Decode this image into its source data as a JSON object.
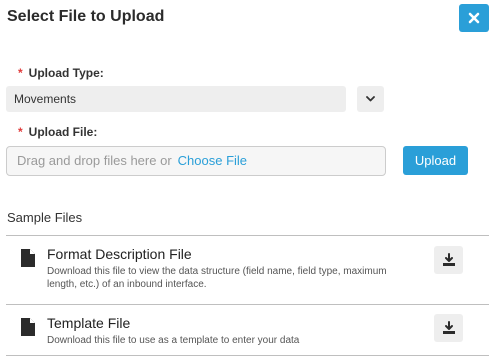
{
  "dialog": {
    "title": "Select File to Upload",
    "close_icon": "close-icon"
  },
  "upload_type": {
    "required_mark": "*",
    "label": "Upload Type:",
    "selected": "Movements",
    "dropdown_icon": "chevron-down-icon"
  },
  "upload_file": {
    "required_mark": "*",
    "label": "Upload File:",
    "drop_text": "Drag and drop files here or",
    "choose_link": "Choose File",
    "upload_button": "Upload"
  },
  "sample_files": {
    "title": "Sample Files",
    "items": [
      {
        "name": "Format Description File",
        "description": "Download this file to view the data structure (field name, field type, maximum length, etc.) of an inbound interface.",
        "icon": "file-icon",
        "action_icon": "download-icon"
      },
      {
        "name": "Template File",
        "description": "Download this file to use as a template to enter your data",
        "icon": "file-icon",
        "action_icon": "download-icon"
      }
    ]
  },
  "colors": {
    "accent": "#2a9fd8",
    "required": "#e03a3a",
    "field_bg": "#eeeeee"
  }
}
